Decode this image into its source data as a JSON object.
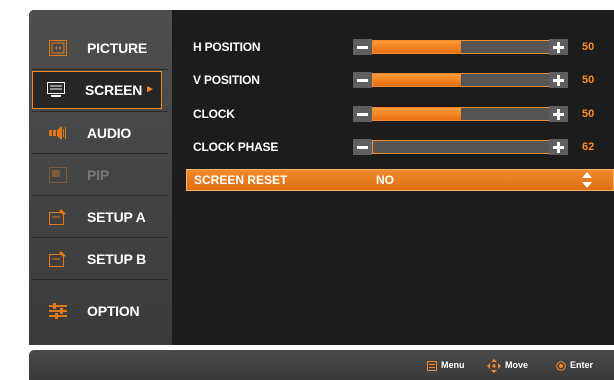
{
  "sidebar": {
    "items": [
      {
        "label": "PICTURE",
        "icon": "picture-icon"
      },
      {
        "label": "SCREEN",
        "icon": "screen-icon",
        "selected": true
      },
      {
        "label": "AUDIO",
        "icon": "audio-icon"
      },
      {
        "label": "PIP",
        "icon": "pip-icon",
        "disabled": true
      },
      {
        "label": "SETUP A",
        "icon": "setup-a-icon"
      },
      {
        "label": "SETUP B",
        "icon": "setup-b-icon"
      },
      {
        "label": "OPTION",
        "icon": "option-icon"
      }
    ],
    "selected_arrow": "►"
  },
  "screen_settings": [
    {
      "label": "H POSITION",
      "value": "50",
      "level": 0.5
    },
    {
      "label": "V POSITION",
      "value": "50",
      "level": 0.5
    },
    {
      "label": "CLOCK",
      "value": "50",
      "level": 0.5
    },
    {
      "label": "CLOCK PHASE",
      "value": "62",
      "level": 0.0
    }
  ],
  "screen_reset": {
    "label": "SCREEN RESET",
    "value": "NO"
  },
  "footer": {
    "menu_label": "Menu",
    "move_label": "Move",
    "enter_label": "Enter"
  },
  "colors": {
    "accent": "#ff8a26",
    "panel": "#1c1c1c",
    "sidebar": "#454545"
  }
}
